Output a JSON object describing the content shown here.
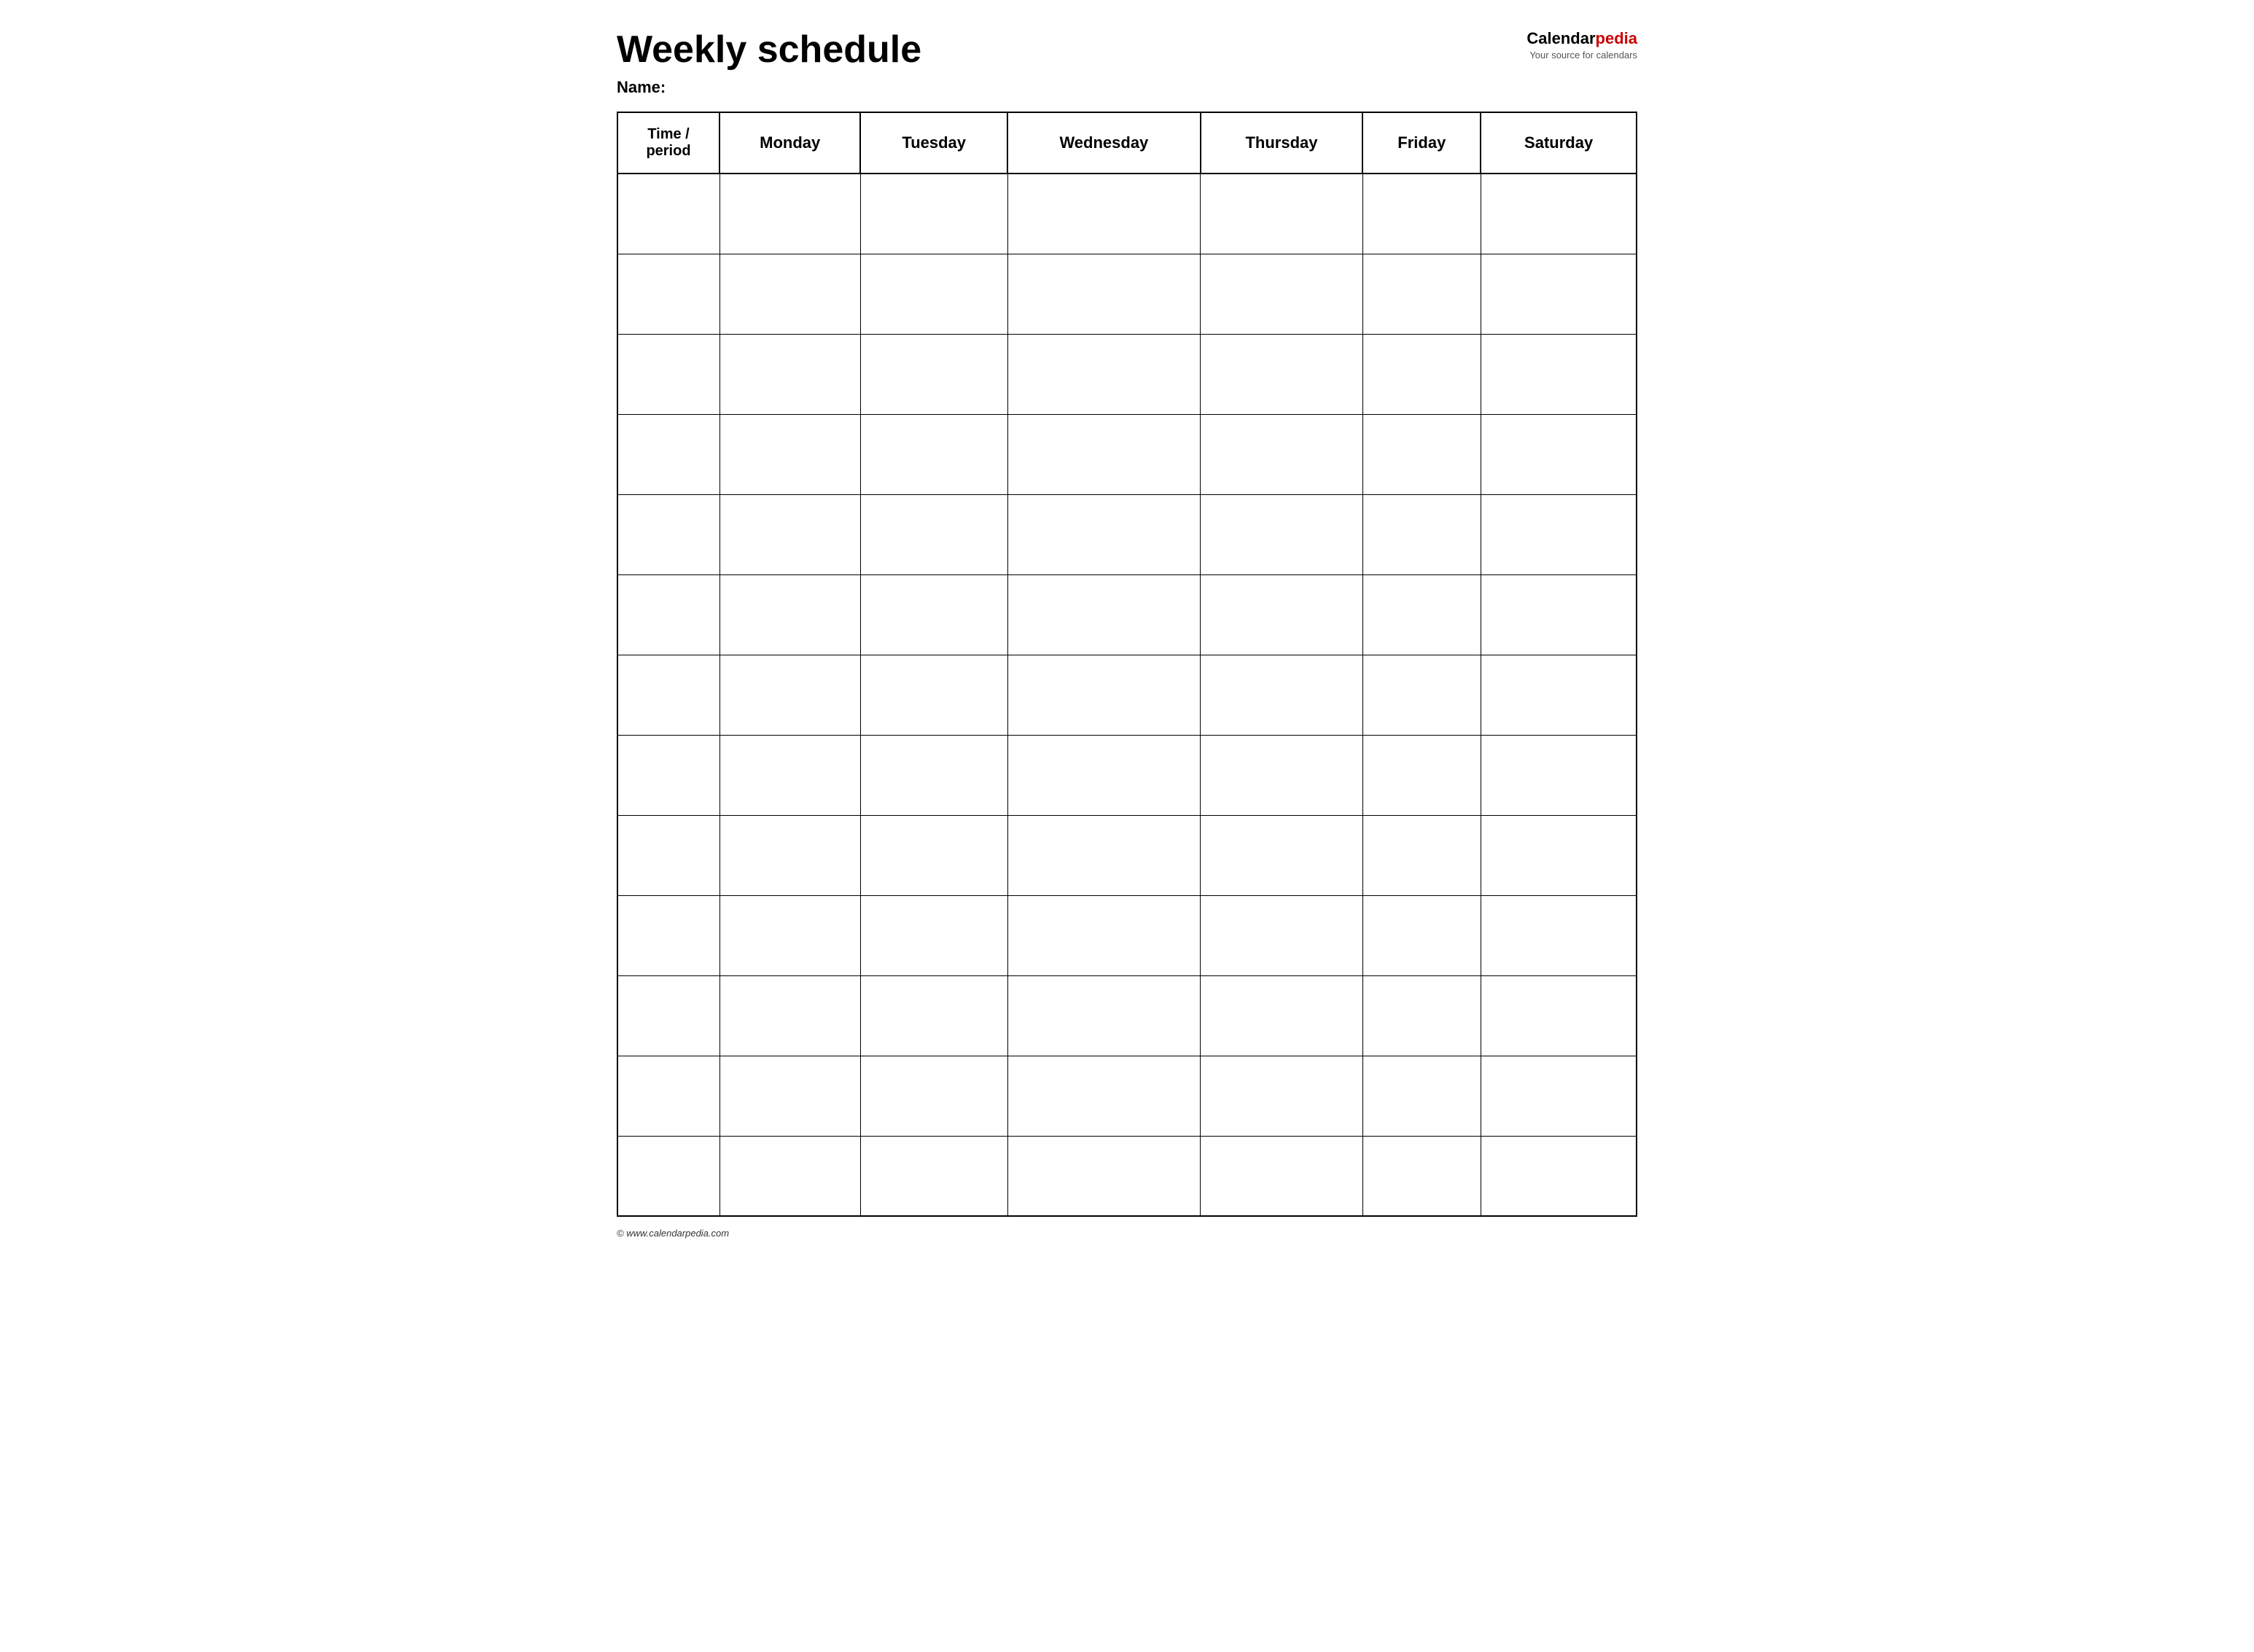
{
  "header": {
    "title": "Weekly schedule",
    "name_label": "Name:",
    "logo": {
      "calendar_part": "Calendar",
      "pedia_part": "pedia",
      "tagline": "Your source for calendars"
    }
  },
  "table": {
    "headers": [
      "Time / period",
      "Monday",
      "Tuesday",
      "Wednesday",
      "Thursday",
      "Friday",
      "Saturday"
    ],
    "row_count": 13
  },
  "footer": {
    "copyright": "© www.calendarpedia.com"
  }
}
